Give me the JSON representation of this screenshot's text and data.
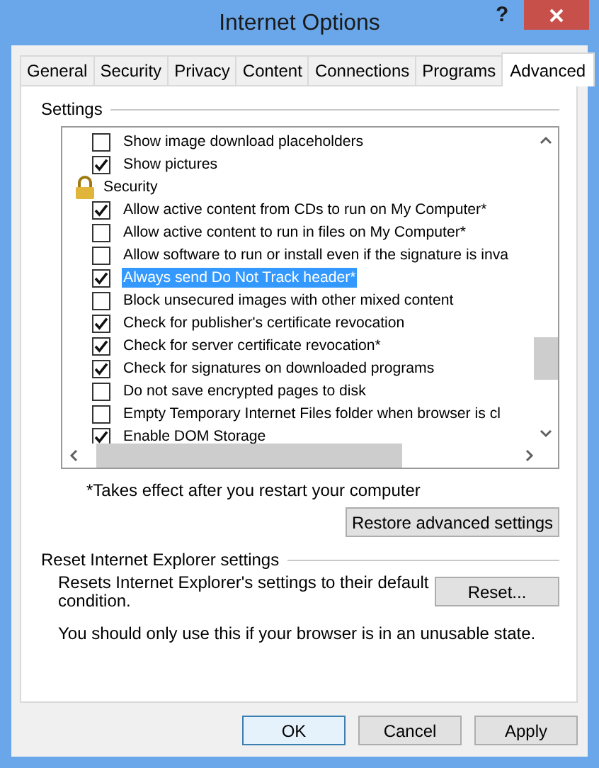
{
  "window": {
    "title": "Internet Options",
    "help": "?"
  },
  "tabs": [
    {
      "label": "General",
      "selected": false
    },
    {
      "label": "Security",
      "selected": false
    },
    {
      "label": "Privacy",
      "selected": false
    },
    {
      "label": "Content",
      "selected": false
    },
    {
      "label": "Connections",
      "selected": false
    },
    {
      "label": "Programs",
      "selected": false
    },
    {
      "label": "Advanced",
      "selected": true
    }
  ],
  "settings": {
    "label": "Settings",
    "items": [
      {
        "kind": "checkbox",
        "label": "Show image download placeholders",
        "checked": false,
        "selected": false
      },
      {
        "kind": "checkbox",
        "label": "Show pictures",
        "checked": true,
        "selected": false
      },
      {
        "kind": "category",
        "label": "Security",
        "selected": false
      },
      {
        "kind": "checkbox",
        "label": "Allow active content from CDs to run on My Computer*",
        "checked": true,
        "selected": false
      },
      {
        "kind": "checkbox",
        "label": "Allow active content to run in files on My Computer*",
        "checked": false,
        "selected": false
      },
      {
        "kind": "checkbox",
        "label": "Allow software to run or install even if the signature is inva",
        "checked": false,
        "selected": false
      },
      {
        "kind": "checkbox",
        "label": "Always send Do Not Track header*",
        "checked": true,
        "selected": true
      },
      {
        "kind": "checkbox",
        "label": "Block unsecured images with other mixed content",
        "checked": false,
        "selected": false
      },
      {
        "kind": "checkbox",
        "label": "Check for publisher's certificate revocation",
        "checked": true,
        "selected": false
      },
      {
        "kind": "checkbox",
        "label": "Check for server certificate revocation*",
        "checked": true,
        "selected": false
      },
      {
        "kind": "checkbox",
        "label": "Check for signatures on downloaded programs",
        "checked": true,
        "selected": false
      },
      {
        "kind": "checkbox",
        "label": "Do not save encrypted pages to disk",
        "checked": false,
        "selected": false
      },
      {
        "kind": "checkbox",
        "label": "Empty Temporary Internet Files folder when browser is cl",
        "checked": false,
        "selected": false
      },
      {
        "kind": "checkbox",
        "label": "Enable DOM Storage",
        "checked": true,
        "selected": false
      }
    ],
    "footnote": "*Takes effect after you restart your computer",
    "restore_button": "Restore advanced settings"
  },
  "reset_group": {
    "label": "Reset Internet Explorer settings",
    "description": "Resets Internet Explorer's settings to their default condition.",
    "reset_button": "Reset...",
    "warning": "You should only use this if your browser is in an unusable state."
  },
  "buttons": [
    {
      "label": "OK",
      "default": true
    },
    {
      "label": "Cancel",
      "default": false
    },
    {
      "label": "Apply",
      "default": false
    }
  ]
}
